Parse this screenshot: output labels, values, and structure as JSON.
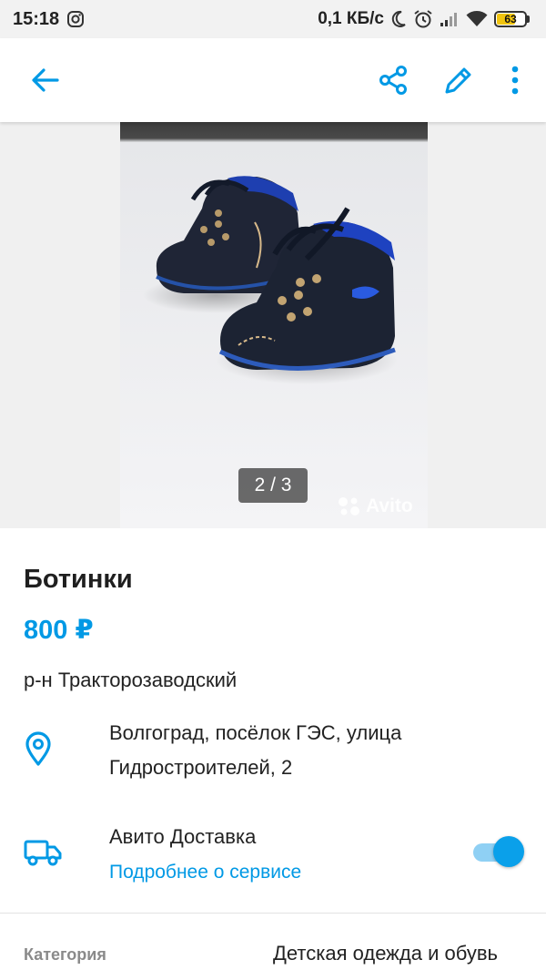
{
  "status_bar": {
    "time": "15:18",
    "network_speed": "0,1 КБ/с",
    "battery": "63",
    "icons": [
      "instagram-icon",
      "moon-icon",
      "alarm-icon",
      "signal-icon",
      "wifi-icon",
      "battery-icon"
    ]
  },
  "toolbar": {
    "icons": [
      "back-arrow-icon",
      "share-icon",
      "edit-pencil-icon",
      "more-vertical-icon"
    ],
    "accent_color": "#0099e5"
  },
  "gallery": {
    "counter": "2 / 3",
    "watermark": "Avito"
  },
  "listing": {
    "title": "Ботинки",
    "price": "800 ₽",
    "district": "р-н Тракторозаводский",
    "address_line1": "Волгоград, посёлок ГЭС, улица",
    "address_line2": "Гидростроителей, 2"
  },
  "delivery": {
    "title": "Авито Доставка",
    "link": "Подробнее о сервисе",
    "enabled": true
  },
  "details": {
    "category_label": "Категория",
    "category_value": "Детская одежда и обувь"
  }
}
